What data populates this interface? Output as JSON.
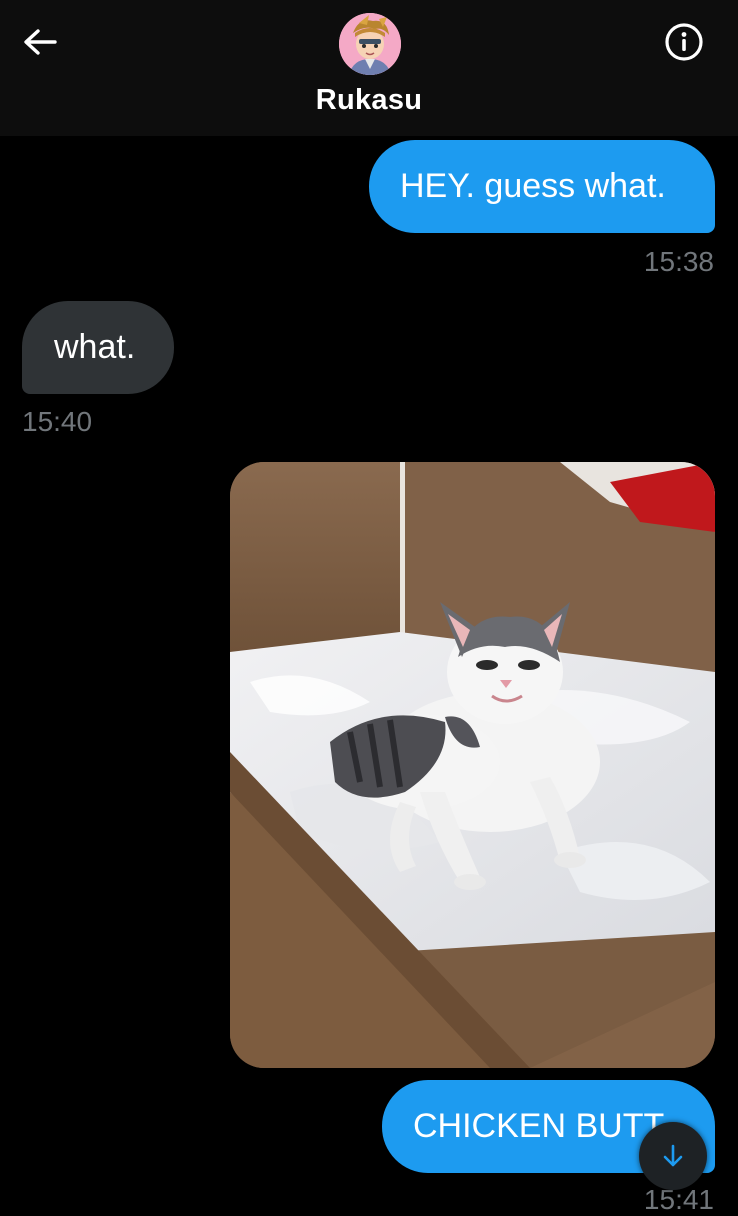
{
  "header": {
    "back_icon": "arrow-left-icon",
    "contact_name": "Rukasu",
    "info_icon": "info-circle-icon"
  },
  "messages": [
    {
      "direction": "outgoing",
      "text": "HEY. guess what.",
      "time": "15:38"
    },
    {
      "direction": "incoming",
      "text": "what.",
      "time": "15:40"
    },
    {
      "direction": "outgoing",
      "type": "image",
      "image_subject": "kitten-in-cardboard-box"
    },
    {
      "direction": "outgoing",
      "text": "CHICKEN BUTT",
      "time": "15:41"
    }
  ],
  "scroll_button_icon": "arrow-down-icon",
  "colors": {
    "outgoing_bubble": "#1d9bf0",
    "incoming_bubble": "#2f3336",
    "background": "#000000",
    "timestamp": "#71767b"
  }
}
